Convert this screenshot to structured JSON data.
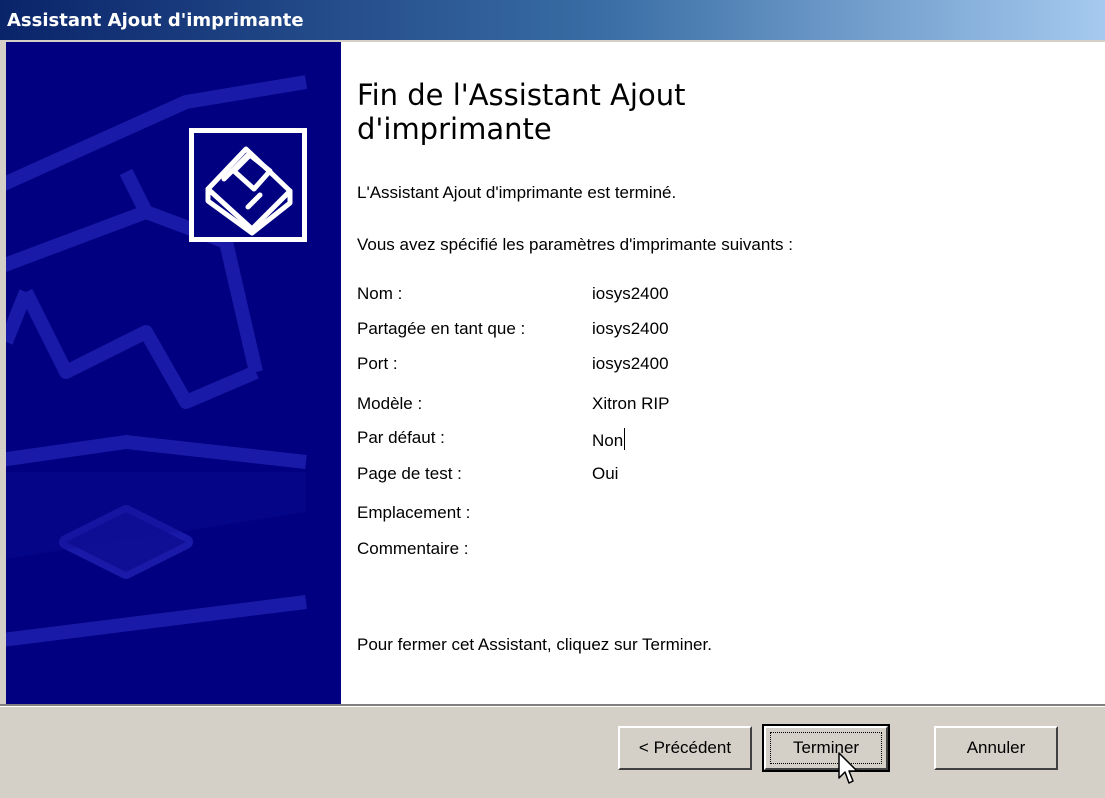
{
  "window": {
    "title": "Assistant Ajout d'imprimante"
  },
  "main": {
    "heading": "Fin de l'Assistant Ajout d'imprimante",
    "completed_text": "L'Assistant Ajout d'imprimante est terminé.",
    "specified_text": "Vous avez spécifié les paramètres d'imprimante suivants :",
    "settings": [
      {
        "label": "Nom :",
        "value": "iosys2400"
      },
      {
        "label": "Partagée en tant que :",
        "value": "iosys2400"
      },
      {
        "label": "Port :",
        "value": "iosys2400"
      },
      {
        "label": "Modèle :",
        "value": "Xitron RIP"
      },
      {
        "label": "Par défaut :",
        "value": "Non"
      },
      {
        "label": "Page de test :",
        "value": "Oui"
      },
      {
        "label": "Emplacement :",
        "value": ""
      },
      {
        "label": "Commentaire :",
        "value": ""
      }
    ],
    "close_text": "Pour fermer cet Assistant, cliquez sur Terminer."
  },
  "buttons": {
    "back": "< Précédent",
    "finish": "Terminer",
    "cancel": "Annuler"
  },
  "icons": {
    "wizard_logo": "printer-icon",
    "cursor": "mouse-pointer-icon"
  },
  "colors": {
    "panel_blue": "#000080",
    "titlebar_start": "#0a246a",
    "face": "#d4d0c8"
  }
}
